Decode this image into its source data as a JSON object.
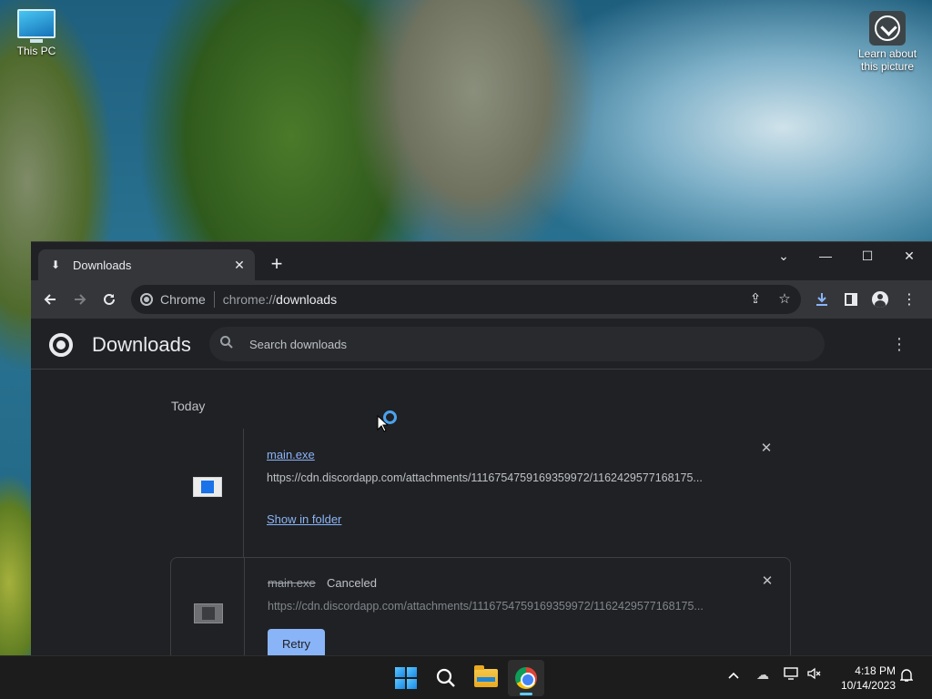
{
  "desktop": {
    "icons": [
      {
        "label": "This PC"
      },
      {
        "label": "Learn about this picture"
      }
    ]
  },
  "browser": {
    "tab": {
      "title": "Downloads",
      "close_glyph": "✕"
    },
    "new_tab_glyph": "+",
    "window_controls": {
      "tab_search": "⌄",
      "minimize": "—",
      "maximize": "☐",
      "close": "✕"
    },
    "omnibox": {
      "site_chip": "Chrome",
      "url_scheme": "chrome://",
      "url_host": "downloads"
    },
    "toolbar_icons": [
      "back-icon",
      "forward-icon",
      "reload-icon",
      "share-icon",
      "star-icon",
      "download-icon",
      "side-panel-icon",
      "profile-icon",
      "menu-icon"
    ]
  },
  "downloads_page": {
    "title": "Downloads",
    "search_placeholder": "Search downloads",
    "section_label": "Today",
    "items": [
      {
        "file_name": "main.exe",
        "status": "",
        "url": "https://cdn.discordapp.com/attachments/1116754759169359972/1162429577168175...",
        "action": "Show in folder"
      },
      {
        "file_name": "main.exe",
        "status": "Canceled",
        "url": "https://cdn.discordapp.com/attachments/1116754759169359972/1162429577168175...",
        "action": "Retry"
      }
    ]
  },
  "taskbar": {
    "apps": [
      "start-icon",
      "search-icon",
      "file-explorer-icon",
      "chrome-icon"
    ],
    "clock": {
      "time": "4:18 PM",
      "date": "10/14/2023"
    }
  },
  "colors": {
    "accent_link": "#8ab4f8",
    "page_bg": "#202124",
    "toolbar_bg": "#35363a",
    "taskbar_bg": "#1c1c1c"
  }
}
